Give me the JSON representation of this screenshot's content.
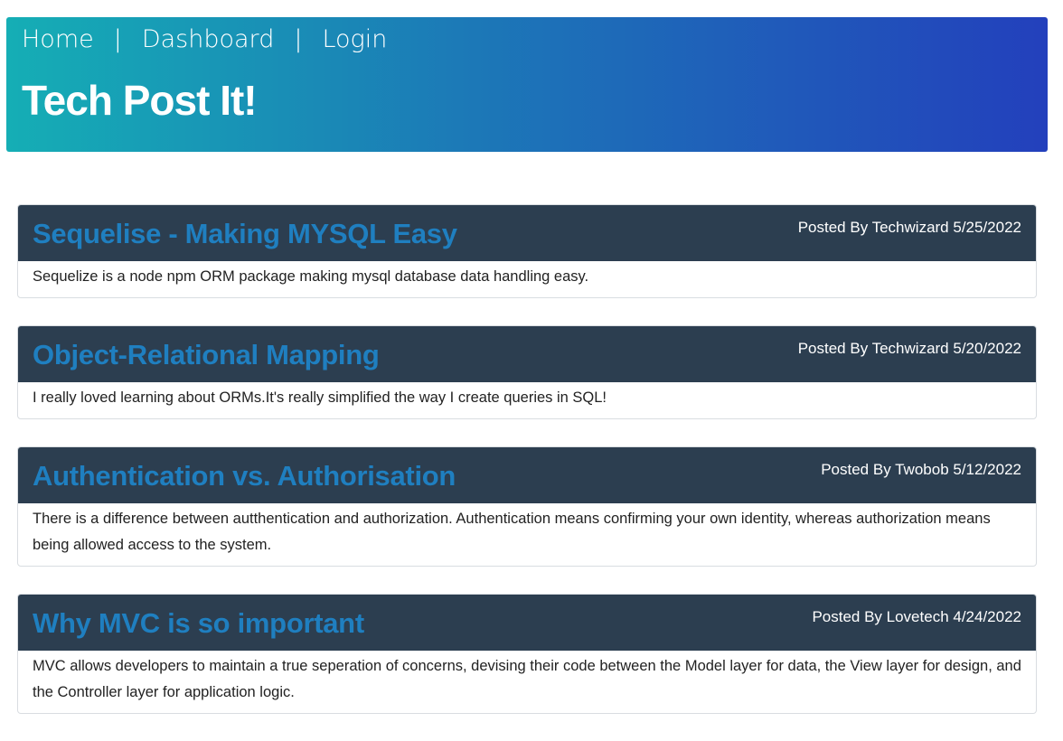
{
  "nav": {
    "home": "Home",
    "separator1": "|",
    "dashboard": "Dashboard",
    "separator2": "|",
    "login": "Login"
  },
  "site": {
    "title": "Tech Post It!"
  },
  "posts": [
    {
      "title": "Sequelise - Making MYSQL Easy",
      "meta": "Posted By Techwizard 5/25/2022",
      "body": "Sequelize is a node npm ORM package making mysql database data handling easy."
    },
    {
      "title": "Object-Relational Mapping",
      "meta": "Posted By Techwizard 5/20/2022",
      "body": "I really loved learning about ORMs.It's really simplified the way I create queries in SQL!"
    },
    {
      "title": "Authentication vs. Authorisation",
      "meta": "Posted By Twobob 5/12/2022",
      "body": "There is a difference between autthentication and authorization. Authentication means confirming your own identity, whereas authorization means being allowed access to the system."
    },
    {
      "title": "Why MVC is so important",
      "meta": "Posted By Lovetech 4/24/2022",
      "body": "MVC allows developers to maintain a true seperation of concerns, devising their code between the Model layer for data, the View layer for design, and the Controller layer for application logic."
    }
  ]
}
